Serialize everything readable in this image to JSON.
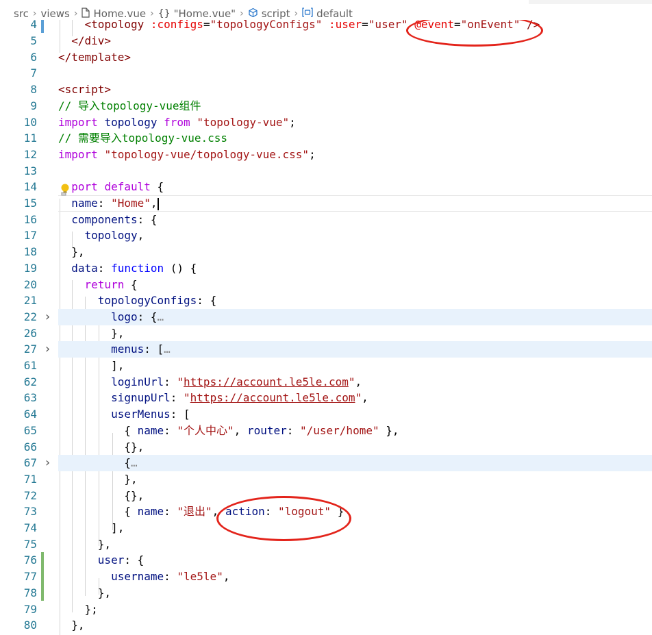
{
  "breadcrumb": {
    "items": [
      {
        "label": "src",
        "icon": ""
      },
      {
        "label": "views",
        "icon": ""
      },
      {
        "label": "Home.vue",
        "icon": "file-icon"
      },
      {
        "label": "\"Home.vue\"",
        "icon": "braces-icon"
      },
      {
        "label": "script",
        "icon": "cube-icon"
      },
      {
        "label": "default",
        "icon": "variable-icon"
      }
    ]
  },
  "lines": [
    {
      "n": "4",
      "tokens": [
        [
          "pl",
          "    "
        ],
        [
          "tag",
          "<topology"
        ],
        [
          "pl",
          " "
        ],
        [
          "attr",
          ":configs"
        ],
        [
          "pl",
          "="
        ],
        [
          "str",
          "\"topologyConfigs\""
        ],
        [
          "pl",
          " "
        ],
        [
          "attr",
          ":user"
        ],
        [
          "pl",
          "="
        ],
        [
          "str",
          "\"user\""
        ],
        [
          "pl",
          " "
        ],
        [
          "attr",
          "@event"
        ],
        [
          "pl",
          "="
        ],
        [
          "str",
          "\"onEvent\""
        ],
        [
          "pl",
          " "
        ],
        [
          "tag",
          "/>"
        ]
      ]
    },
    {
      "n": "5",
      "tokens": [
        [
          "pl",
          "  "
        ],
        [
          "tag",
          "</div>"
        ]
      ]
    },
    {
      "n": "6",
      "tokens": [
        [
          "tag",
          "</template>"
        ]
      ]
    },
    {
      "n": "7",
      "tokens": []
    },
    {
      "n": "8",
      "tokens": [
        [
          "tag",
          "<script>"
        ]
      ]
    },
    {
      "n": "9",
      "tokens": [
        [
          "cm",
          "// 导入topology-vue组件"
        ]
      ]
    },
    {
      "n": "10",
      "tokens": [
        [
          "kwc",
          "import"
        ],
        [
          "pl",
          " "
        ],
        [
          "id",
          "topology"
        ],
        [
          "pl",
          " "
        ],
        [
          "kwc",
          "from"
        ],
        [
          "pl",
          " "
        ],
        [
          "str",
          "\"topology-vue\""
        ],
        [
          "pl",
          ";"
        ]
      ]
    },
    {
      "n": "11",
      "tokens": [
        [
          "cm",
          "// 需要导入topology-vue.css"
        ]
      ]
    },
    {
      "n": "12",
      "tokens": [
        [
          "kwc",
          "import"
        ],
        [
          "pl",
          " "
        ],
        [
          "str",
          "\"topology-vue/topology-vue.css\""
        ],
        [
          "pl",
          ";"
        ]
      ]
    },
    {
      "n": "13",
      "tokens": []
    },
    {
      "n": "14",
      "tokens": [
        [
          "pl",
          "  "
        ],
        [
          "kwc",
          "port"
        ],
        [
          "pl",
          " "
        ],
        [
          "kwc",
          "default"
        ],
        [
          "pl",
          " {"
        ]
      ]
    },
    {
      "n": "15",
      "tokens": [
        [
          "pl",
          "  "
        ],
        [
          "prop",
          "name"
        ],
        [
          "pl",
          ": "
        ],
        [
          "str",
          "\"Home\""
        ],
        [
          "pl",
          ","
        ]
      ]
    },
    {
      "n": "16",
      "tokens": [
        [
          "pl",
          "  "
        ],
        [
          "prop",
          "components"
        ],
        [
          "pl",
          ": {"
        ]
      ]
    },
    {
      "n": "17",
      "tokens": [
        [
          "pl",
          "    "
        ],
        [
          "prop",
          "topology"
        ],
        [
          "pl",
          ","
        ]
      ]
    },
    {
      "n": "18",
      "tokens": [
        [
          "pl",
          "  },"
        ]
      ]
    },
    {
      "n": "19",
      "tokens": [
        [
          "pl",
          "  "
        ],
        [
          "prop",
          "data"
        ],
        [
          "pl",
          ": "
        ],
        [
          "kw",
          "function"
        ],
        [
          "pl",
          " () {"
        ]
      ]
    },
    {
      "n": "20",
      "tokens": [
        [
          "pl",
          "    "
        ],
        [
          "kwc",
          "return"
        ],
        [
          "pl",
          " {"
        ]
      ]
    },
    {
      "n": "21",
      "tokens": [
        [
          "pl",
          "      "
        ],
        [
          "prop",
          "topologyConfigs"
        ],
        [
          "pl",
          ": {"
        ]
      ]
    },
    {
      "n": "22",
      "tokens": [
        [
          "pl",
          "        "
        ],
        [
          "prop",
          "logo"
        ],
        [
          "pl",
          ": {"
        ],
        [
          "dots",
          "…"
        ]
      ]
    },
    {
      "n": "26",
      "tokens": [
        [
          "pl",
          "        },"
        ]
      ]
    },
    {
      "n": "27",
      "tokens": [
        [
          "pl",
          "        "
        ],
        [
          "prop",
          "menus"
        ],
        [
          "pl",
          ": ["
        ],
        [
          "dots",
          "…"
        ]
      ]
    },
    {
      "n": "61",
      "tokens": [
        [
          "pl",
          "        ],"
        ]
      ]
    },
    {
      "n": "62",
      "tokens": [
        [
          "pl",
          "        "
        ],
        [
          "prop",
          "loginUrl"
        ],
        [
          "pl",
          ": "
        ],
        [
          "str",
          "\""
        ],
        [
          "url",
          "https://account.le5le.com"
        ],
        [
          "str",
          "\""
        ],
        [
          "pl",
          ","
        ]
      ]
    },
    {
      "n": "63",
      "tokens": [
        [
          "pl",
          "        "
        ],
        [
          "prop",
          "signupUrl"
        ],
        [
          "pl",
          ": "
        ],
        [
          "str",
          "\""
        ],
        [
          "url",
          "https://account.le5le.com"
        ],
        [
          "str",
          "\""
        ],
        [
          "pl",
          ","
        ]
      ]
    },
    {
      "n": "64",
      "tokens": [
        [
          "pl",
          "        "
        ],
        [
          "prop",
          "userMenus"
        ],
        [
          "pl",
          ": ["
        ]
      ]
    },
    {
      "n": "65",
      "tokens": [
        [
          "pl",
          "          { "
        ],
        [
          "prop",
          "name"
        ],
        [
          "pl",
          ": "
        ],
        [
          "str",
          "\"个人中心\""
        ],
        [
          "pl",
          ", "
        ],
        [
          "prop",
          "router"
        ],
        [
          "pl",
          ": "
        ],
        [
          "str",
          "\"/user/home\""
        ],
        [
          "pl",
          " },"
        ]
      ]
    },
    {
      "n": "66",
      "tokens": [
        [
          "pl",
          "          {},"
        ]
      ]
    },
    {
      "n": "67",
      "tokens": [
        [
          "pl",
          "          {"
        ],
        [
          "dots",
          "…"
        ]
      ]
    },
    {
      "n": "71",
      "tokens": [
        [
          "pl",
          "          },"
        ]
      ]
    },
    {
      "n": "72",
      "tokens": [
        [
          "pl",
          "          {},"
        ]
      ]
    },
    {
      "n": "73",
      "tokens": [
        [
          "pl",
          "          { "
        ],
        [
          "prop",
          "name"
        ],
        [
          "pl",
          ": "
        ],
        [
          "str",
          "\"退出\""
        ],
        [
          "pl",
          ", "
        ],
        [
          "prop",
          "action"
        ],
        [
          "pl",
          ": "
        ],
        [
          "str",
          "\"logout\""
        ],
        [
          "pl",
          " }"
        ]
      ]
    },
    {
      "n": "74",
      "tokens": [
        [
          "pl",
          "        ],"
        ]
      ]
    },
    {
      "n": "75",
      "tokens": [
        [
          "pl",
          "      },"
        ]
      ]
    },
    {
      "n": "76",
      "tokens": [
        [
          "pl",
          "      "
        ],
        [
          "prop",
          "user"
        ],
        [
          "pl",
          ": {"
        ]
      ]
    },
    {
      "n": "77",
      "tokens": [
        [
          "pl",
          "        "
        ],
        [
          "prop",
          "username"
        ],
        [
          "pl",
          ": "
        ],
        [
          "str",
          "\"le5le\""
        ],
        [
          "pl",
          ","
        ]
      ]
    },
    {
      "n": "78",
      "tokens": [
        [
          "pl",
          "      },"
        ]
      ]
    },
    {
      "n": "79",
      "tokens": [
        [
          "pl",
          "    };"
        ]
      ]
    },
    {
      "n": "80",
      "tokens": [
        [
          "pl",
          "  },"
        ]
      ]
    }
  ],
  "colors": {
    "tag": "#800000",
    "attr": "#e50000",
    "string": "#a31515",
    "keyword": "#0000ff",
    "control_keyword": "#af00db",
    "comment": "#008000",
    "property": "#001080",
    "line_number": "#237893",
    "annotation_circle": "#e3241b"
  }
}
